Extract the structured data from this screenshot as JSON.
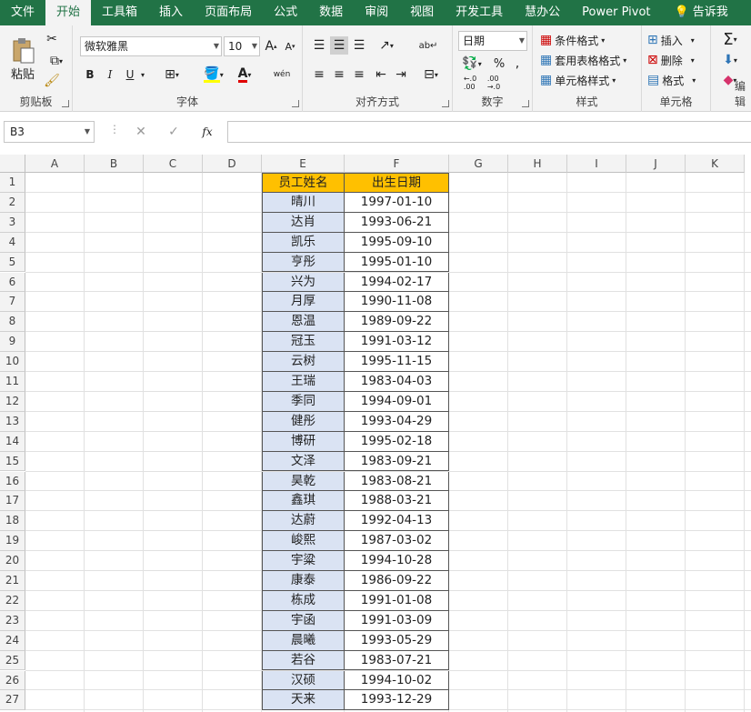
{
  "ribbon_tabs": [
    {
      "label": "文件"
    },
    {
      "label": "开始"
    },
    {
      "label": "工具箱"
    },
    {
      "label": "插入"
    },
    {
      "label": "页面布局"
    },
    {
      "label": "公式"
    },
    {
      "label": "数据"
    },
    {
      "label": "审阅"
    },
    {
      "label": "视图"
    },
    {
      "label": "开发工具"
    },
    {
      "label": "慧办公"
    },
    {
      "label": "Power Pivot"
    }
  ],
  "tell_me": "告诉我",
  "clipboard": {
    "paste": "粘贴",
    "label": "剪贴板"
  },
  "font": {
    "name": "微软雅黑",
    "size": "10",
    "label": "字体",
    "bold": "B",
    "italic": "I",
    "underline": "U",
    "phonetic": "wén"
  },
  "alignment": {
    "label": "对齐方式"
  },
  "number": {
    "format": "日期",
    "percent": "%",
    "comma": ",",
    "label": "数字"
  },
  "styles": {
    "conditional": "条件格式",
    "table": "套用表格格式",
    "cell": "单元格样式",
    "label": "样式"
  },
  "cells": {
    "insert": "插入",
    "delete": "删除",
    "format": "格式",
    "label": "单元格"
  },
  "editing": {
    "label": "编辑"
  },
  "formula_bar": {
    "namebox": "B3",
    "fx": "fx",
    "value": ""
  },
  "columns": [
    "A",
    "B",
    "C",
    "D",
    "E",
    "F",
    "G",
    "H",
    "I",
    "J",
    "K"
  ],
  "rows": [
    "1",
    "2",
    "3",
    "4",
    "5",
    "6",
    "7",
    "8",
    "9",
    "10",
    "11",
    "12",
    "13",
    "14",
    "15",
    "16",
    "17",
    "18",
    "19",
    "20",
    "21",
    "22",
    "23",
    "24",
    "25",
    "26",
    "27"
  ],
  "table": {
    "headers": [
      "员工姓名",
      "出生日期"
    ],
    "rows": [
      [
        "晴川",
        "1997-01-10"
      ],
      [
        "达肖",
        "1993-06-21"
      ],
      [
        "凯乐",
        "1995-09-10"
      ],
      [
        "亨彤",
        "1995-01-10"
      ],
      [
        "兴为",
        "1994-02-17"
      ],
      [
        "月厚",
        "1990-11-08"
      ],
      [
        "恩温",
        "1989-09-22"
      ],
      [
        "冠玉",
        "1991-03-12"
      ],
      [
        "云树",
        "1995-11-15"
      ],
      [
        "王瑞",
        "1983-04-03"
      ],
      [
        "季同",
        "1994-09-01"
      ],
      [
        "健彤",
        "1993-04-29"
      ],
      [
        "博研",
        "1995-02-18"
      ],
      [
        "文泽",
        "1983-09-21"
      ],
      [
        "昊乾",
        "1983-08-21"
      ],
      [
        "鑫琪",
        "1988-03-21"
      ],
      [
        "达蔚",
        "1992-04-13"
      ],
      [
        "峻熙",
        "1987-03-02"
      ],
      [
        "宇粱",
        "1994-10-28"
      ],
      [
        "康泰",
        "1986-09-22"
      ],
      [
        "栋成",
        "1991-01-08"
      ],
      [
        "宇函",
        "1991-03-09"
      ],
      [
        "晨曦",
        "1993-05-29"
      ],
      [
        "若谷",
        "1983-07-21"
      ],
      [
        "汉硕",
        "1994-10-02"
      ],
      [
        "天来",
        "1993-12-29"
      ]
    ]
  },
  "colors": {
    "ribbon_green": "#217346",
    "header_fill": "#ffc000",
    "name_fill": "#dae3f3"
  }
}
